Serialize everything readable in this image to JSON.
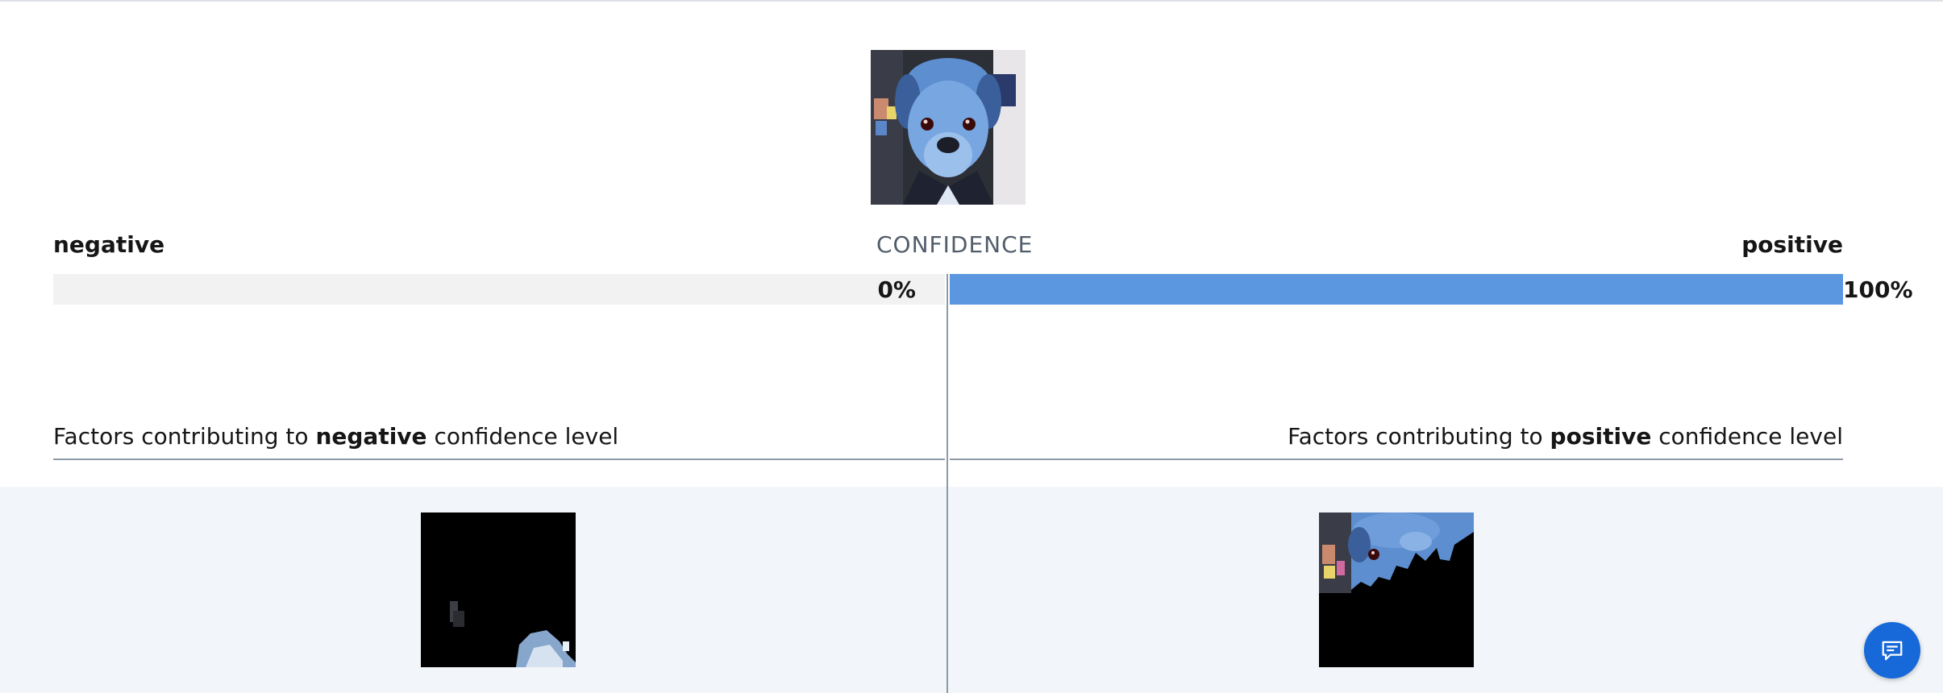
{
  "confidence": {
    "title": "CONFIDENCE",
    "negative_label": "negative",
    "positive_label": "positive",
    "negative_value": 0,
    "positive_value": 100,
    "negative_percent_text": "0%",
    "positive_percent_text": "100%"
  },
  "factors": {
    "negative": {
      "prefix": "Factors contributing to ",
      "keyword": "negative",
      "suffix": " confidence level"
    },
    "positive": {
      "prefix": "Factors contributing to ",
      "keyword": "positive",
      "suffix": " confidence level"
    }
  },
  "images": {
    "main": "dog-portrait-image",
    "negative_factor": "negative-factor-mask-image",
    "positive_factor": "positive-factor-mask-image"
  },
  "chat": {
    "icon": "chat-icon"
  },
  "colors": {
    "bar_fill": "#5a97e0",
    "bar_track": "#f2f2f2",
    "band": "#f2f5f9",
    "chat_button": "#1768d8"
  }
}
